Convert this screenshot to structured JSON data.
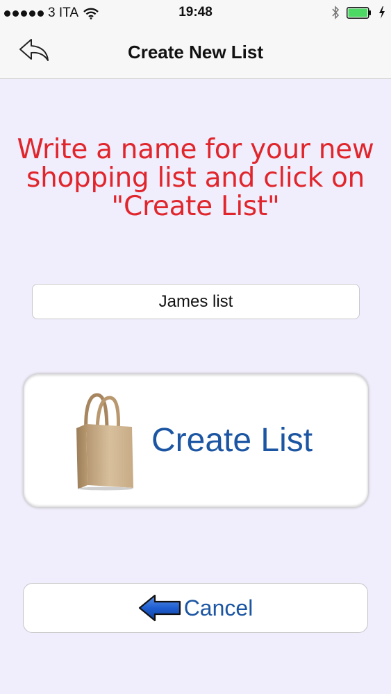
{
  "status_bar": {
    "carrier": "3 ITA",
    "time": "19:48",
    "icons": [
      "signal-dots",
      "wifi-icon",
      "bluetooth-icon",
      "battery-icon",
      "charging-bolt-icon"
    ]
  },
  "nav": {
    "title": "Create New List",
    "back_icon": "reply-arrow-icon"
  },
  "instruction": {
    "text": "Write a name for your new shopping list and click on \"Create List\""
  },
  "list_name_input": {
    "value": "James list"
  },
  "create_button": {
    "label": "Create List",
    "icon": "shopping-bag-icon"
  },
  "cancel_button": {
    "label": "Cancel",
    "icon": "left-arrow-icon"
  },
  "colors": {
    "background": "#f0edfc",
    "instruction_text": "#e0262c",
    "button_text": "#1c56a3",
    "battery": "#4cd964"
  }
}
